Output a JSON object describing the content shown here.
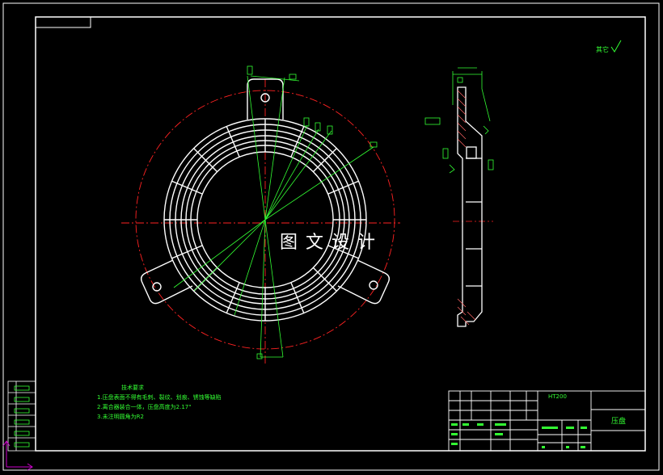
{
  "watermark": "图文设计",
  "roughness_note": "其它",
  "technical_requirements": {
    "title": "技术要求",
    "items": [
      "1.压盘表面不得有毛刺、裂纹、划痕、锈蚀等缺陷",
      "2.离合器装合一体，压盘高度为2.17\"",
      "3.未注明圆角为R2"
    ]
  },
  "title_block": {
    "material": "HT200",
    "part_name": "压盘"
  },
  "colors": {
    "background": "#000000",
    "outline": "#ffffff",
    "centerline": "#ff2020",
    "dimension": "#33ff33"
  }
}
